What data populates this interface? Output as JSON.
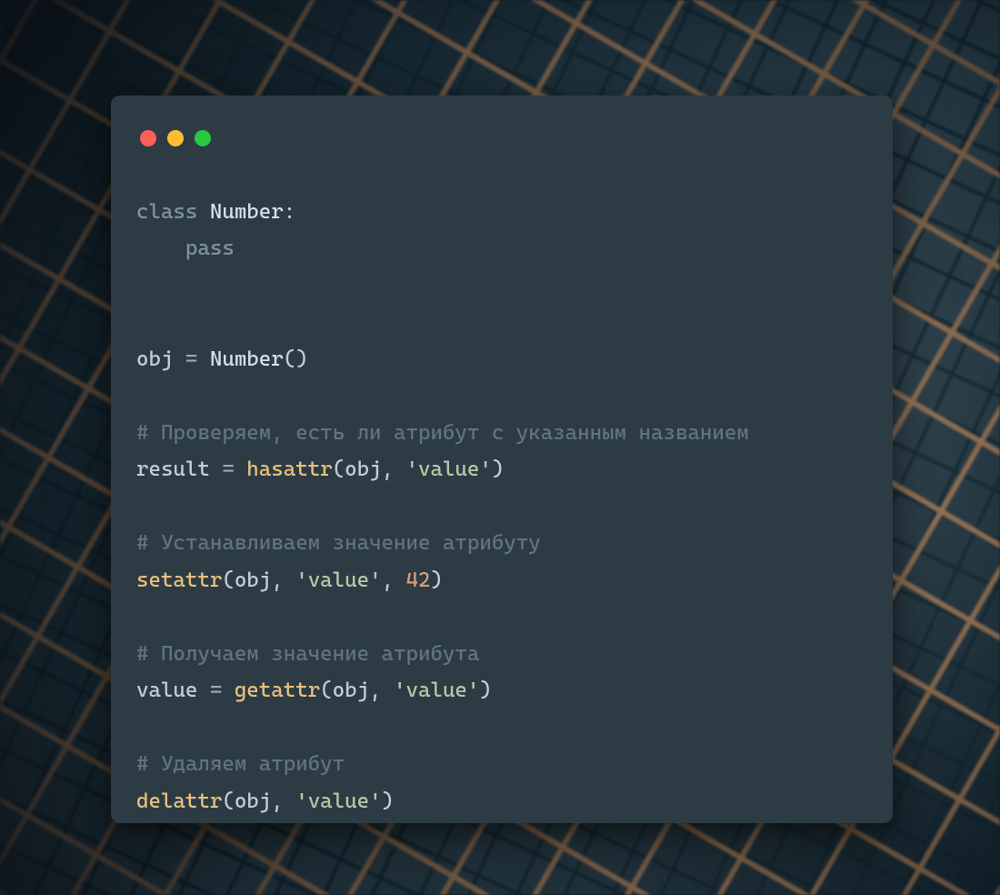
{
  "window": {
    "traffic_lights": {
      "red": "#ff5f57",
      "yellow": "#ffbd2e",
      "green": "#28c940"
    }
  },
  "syntax_colors": {
    "keyword": "#7f93a2",
    "classname": "#d8dee9",
    "identifier": "#c3cdd6",
    "operator": "#9aa8b3",
    "builtin": "#e8c07d",
    "string": "#b8c7a4",
    "number": "#d6a07b",
    "comment": "#5f7484",
    "background": "#2d3b45"
  },
  "code": {
    "l1_class": "class ",
    "l1_name": "Number",
    "l1_colon": ":",
    "l2_indent": "    ",
    "l2_pass": "pass",
    "l5_obj": "obj ",
    "l5_eq": "= ",
    "l5_ctor": "Number",
    "l5_par": "()",
    "c1": "# Проверяем, есть ли атрибут с указанным названием",
    "l8_res": "result ",
    "l8_eq": "= ",
    "l8_fn": "hasattr",
    "l8_open": "(",
    "l8_obj": "obj",
    "l8_c1": ", ",
    "l8_s": "'value'",
    "l8_close": ")",
    "c2": "# Устанавливаем значение атрибуту",
    "l11_fn": "setattr",
    "l11_open": "(",
    "l11_obj": "obj",
    "l11_c1": ", ",
    "l11_s": "'value'",
    "l11_c2": ", ",
    "l11_num": "42",
    "l11_close": ")",
    "c3": "# Получаем значение атрибута",
    "l14_val": "value ",
    "l14_eq": "= ",
    "l14_fn": "getattr",
    "l14_open": "(",
    "l14_obj": "obj",
    "l14_c1": ", ",
    "l14_s": "'value'",
    "l14_close": ")",
    "c4": "# Удаляем атрибут",
    "l17_fn": "delattr",
    "l17_open": "(",
    "l17_obj": "obj",
    "l17_c1": ", ",
    "l17_s": "'value'",
    "l17_close": ")"
  }
}
